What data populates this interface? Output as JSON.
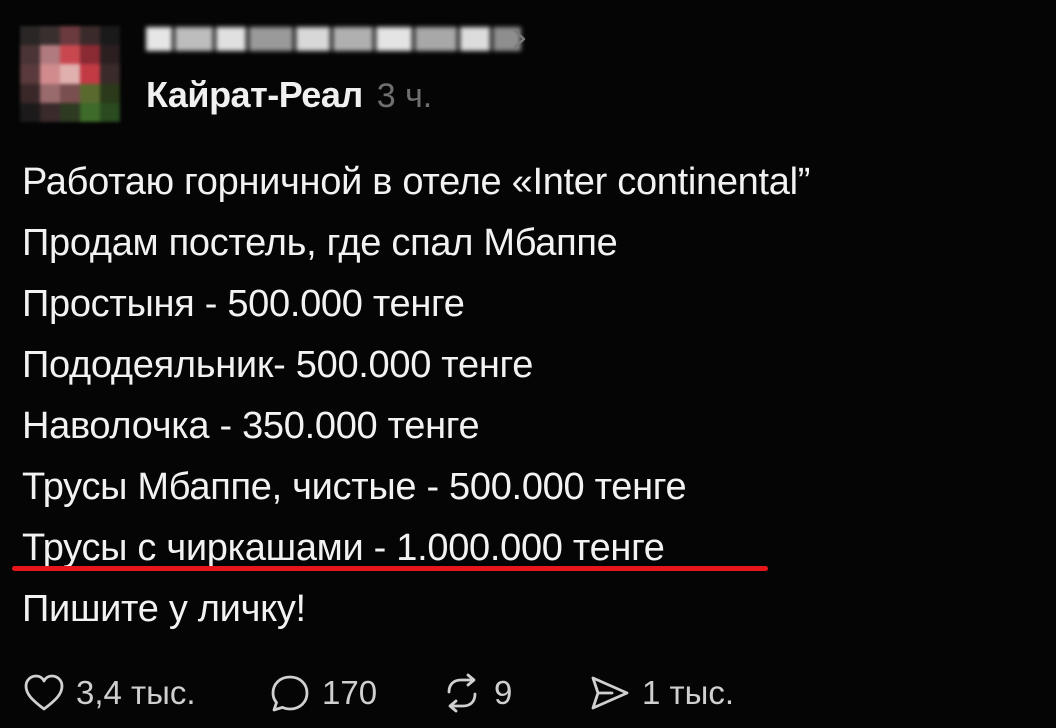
{
  "post": {
    "community_name": "Кайрат-Реал",
    "time": "3 ч.",
    "lines": [
      "Работаю горничной в отеле «Inter continental”",
      "Продам постель, где спал Мбаппе",
      "Простыня - 500.000 тенге",
      "Пододеяльник- 500.000 тенге",
      "Наволочка - 350.000 тенге",
      "Трусы Мбаппе, чистые - 500.000 тенге",
      "Трусы с чиркашами - 1.000.000 тенге",
      "Пишите у личку!"
    ],
    "highlight_color": "#e8161b"
  },
  "actions": {
    "like": {
      "icon": "heart-icon",
      "count": "3,4 тыс."
    },
    "comment": {
      "icon": "comment-bubble-icon",
      "count": "170"
    },
    "repost": {
      "icon": "repost-icon",
      "count": "9"
    },
    "share": {
      "icon": "send-icon",
      "count": "1 тыс."
    }
  }
}
